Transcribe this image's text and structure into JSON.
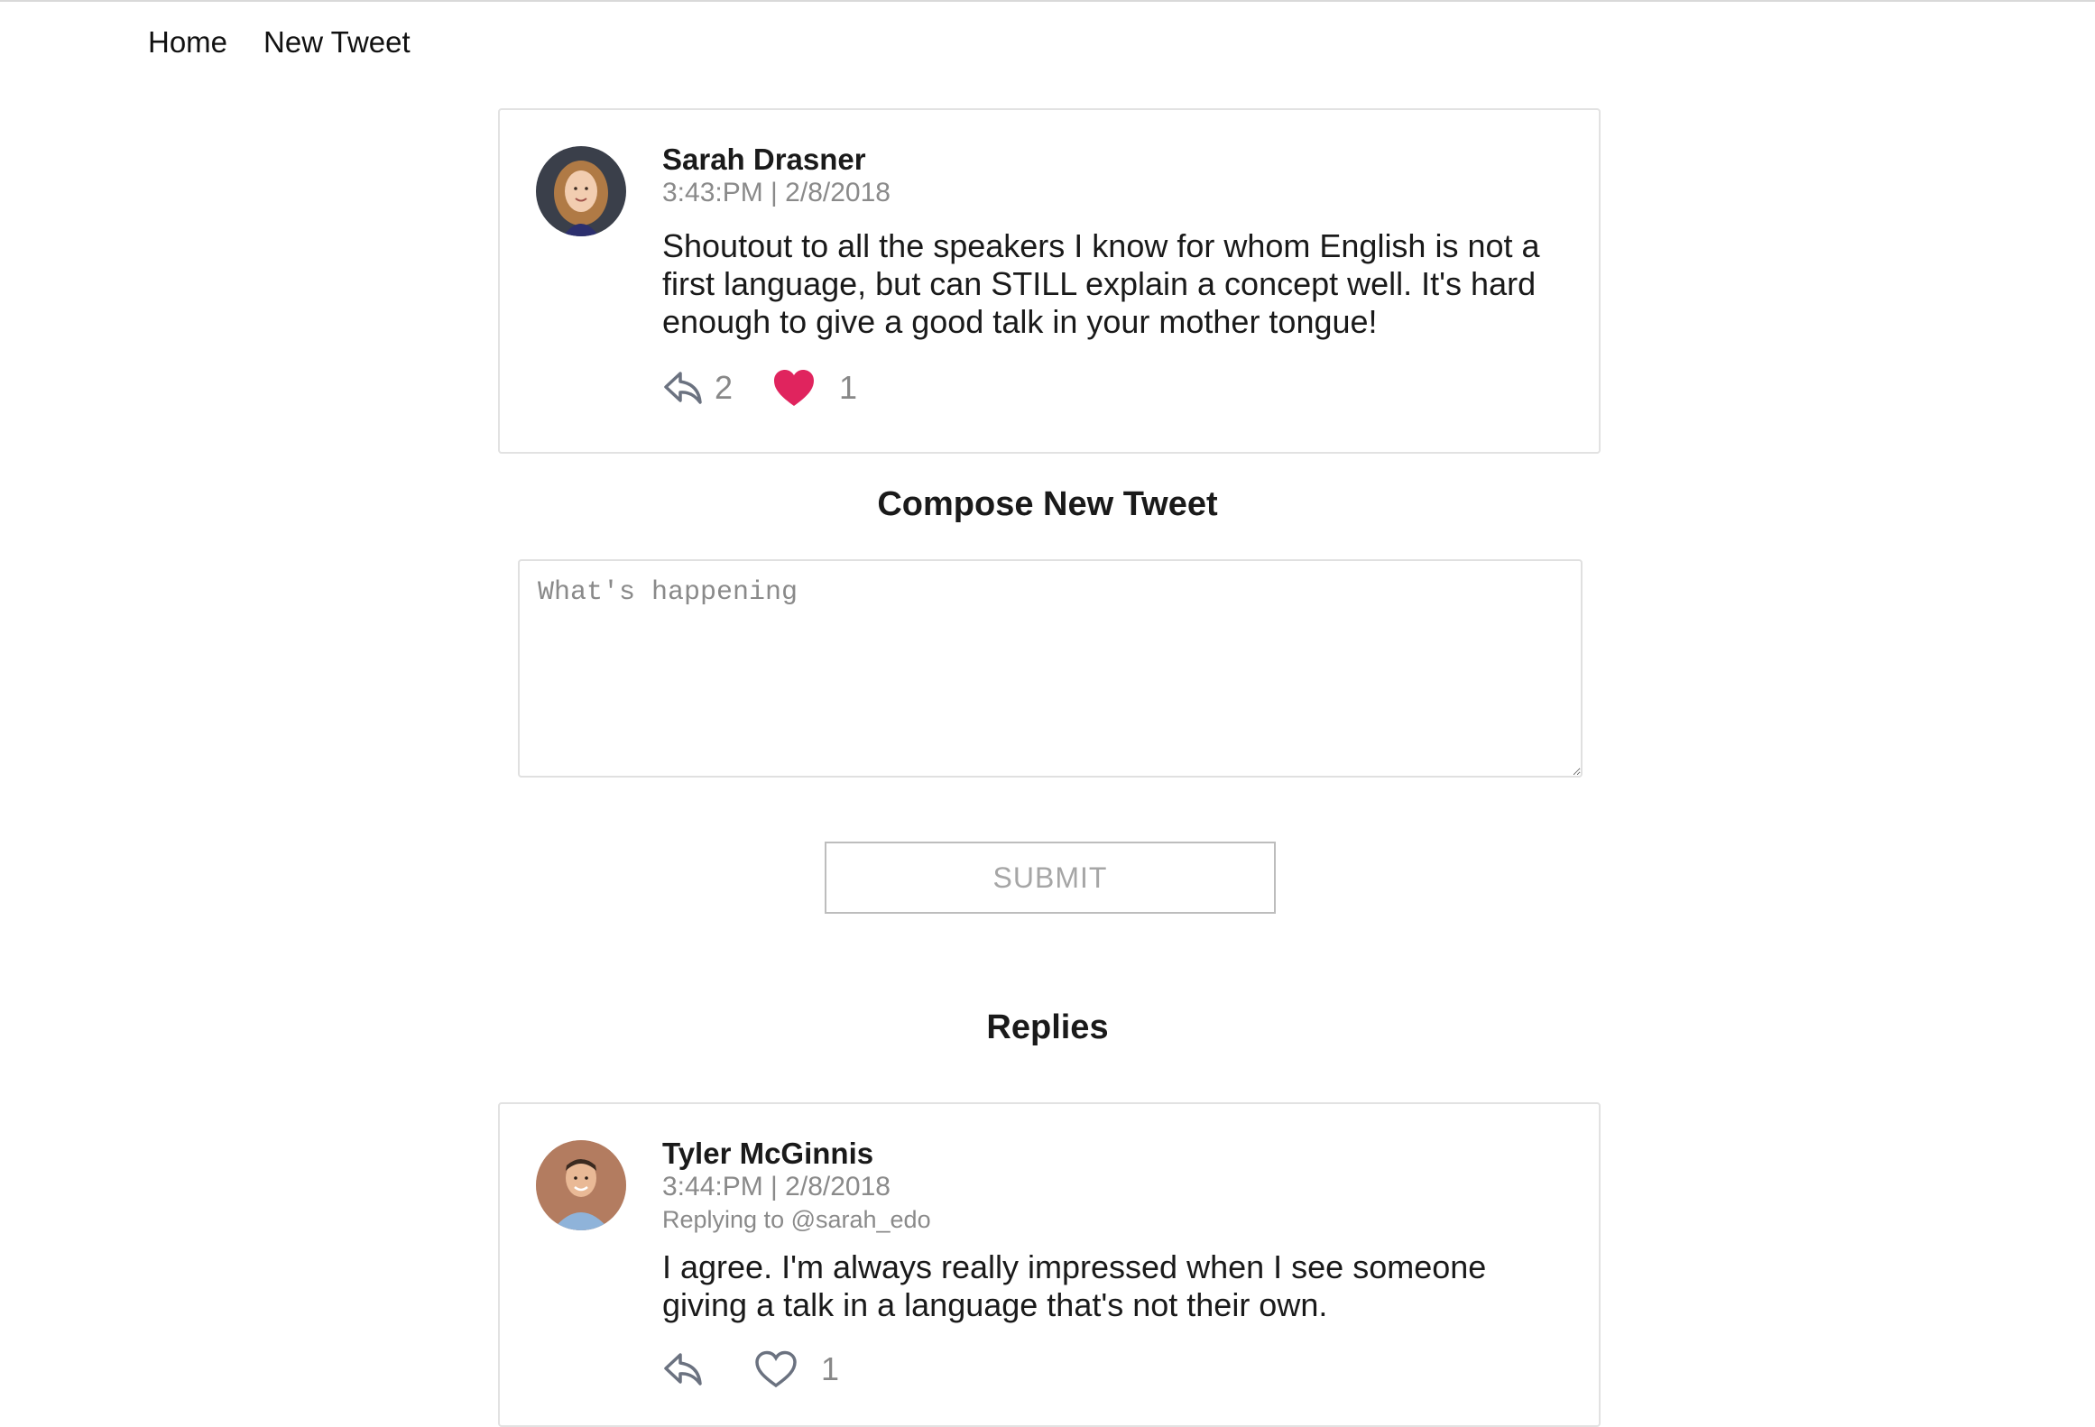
{
  "nav": {
    "home_label": "Home",
    "new_tweet_label": "New Tweet"
  },
  "main_tweet": {
    "author": "Sarah Drasner",
    "meta": "3:43:PM | 2/8/2018",
    "text": "Shoutout to all the speakers I know for whom English is not a first language, but can STILL explain a concept well. It's hard enough to give a good talk in your mother tongue!",
    "reply_count": "2",
    "like_count": "1",
    "liked": true,
    "like_color": "#e0245e"
  },
  "compose": {
    "title": "Compose New Tweet",
    "placeholder": "What's happening",
    "submit_label": "SUBMIT"
  },
  "replies": {
    "title": "Replies",
    "items": [
      {
        "author": "Tyler McGinnis",
        "meta": "3:44:PM | 2/8/2018",
        "replying_to": "Replying to @sarah_edo",
        "text": "I agree. I'm always really impressed when I see someone giving a talk in a language that's not their own.",
        "reply_count": "",
        "like_count": "1",
        "liked": false
      }
    ]
  },
  "colors": {
    "icon_gray": "#6b7280",
    "muted_text": "#8a8a8a",
    "border": "#e2e2e2"
  }
}
